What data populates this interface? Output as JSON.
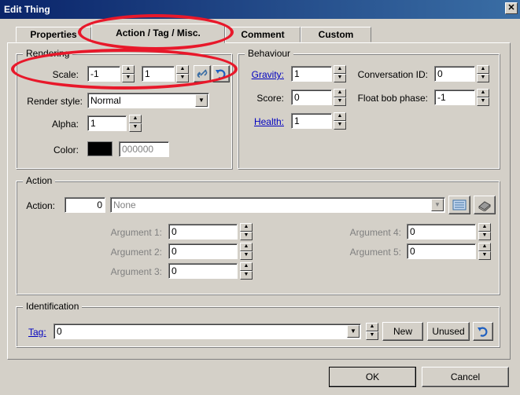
{
  "window": {
    "title": "Edit Thing",
    "close_glyph": "✕"
  },
  "tabs": [
    {
      "label": "Properties",
      "active": false
    },
    {
      "label": "Action / Tag / Misc.",
      "active": true
    },
    {
      "label": "Comment",
      "active": false
    },
    {
      "label": "Custom",
      "active": false
    }
  ],
  "rendering": {
    "legend": "Rendering",
    "scale_label": "Scale:",
    "scale_x": "-1",
    "scale_y": "1",
    "render_style_label": "Render style:",
    "render_style_value": "Normal",
    "alpha_label": "Alpha:",
    "alpha_value": "1",
    "color_label": "Color:",
    "color_hex": "000000",
    "color_swatch": "#000000"
  },
  "behaviour": {
    "legend": "Behaviour",
    "gravity_label": "Gravity:",
    "gravity_value": "1",
    "score_label": "Score:",
    "score_value": "0",
    "health_label": "Health:",
    "health_value": "1",
    "conversation_label": "Conversation ID:",
    "conversation_value": "0",
    "floatbob_label": "Float bob phase:",
    "floatbob_value": "-1"
  },
  "action": {
    "legend": "Action",
    "action_label": "Action:",
    "action_number": "0",
    "action_name": "None",
    "arguments": [
      {
        "label": "Argument 1:",
        "value": "0"
      },
      {
        "label": "Argument 2:",
        "value": "0"
      },
      {
        "label": "Argument 3:",
        "value": "0"
      },
      {
        "label": "Argument 4:",
        "value": "0"
      },
      {
        "label": "Argument 5:",
        "value": "0"
      }
    ]
  },
  "identification": {
    "legend": "Identification",
    "tag_label": "Tag:",
    "tag_value": "0",
    "new_label": "New",
    "unused_label": "Unused"
  },
  "footer": {
    "ok_label": "OK",
    "cancel_label": "Cancel"
  },
  "colors": {
    "annotation": "#e8182a",
    "link": "#0000c0",
    "accent": "#3a6ea5"
  },
  "icons": {
    "spin_up": "▲",
    "spin_down": "▼",
    "combo": "▼"
  }
}
